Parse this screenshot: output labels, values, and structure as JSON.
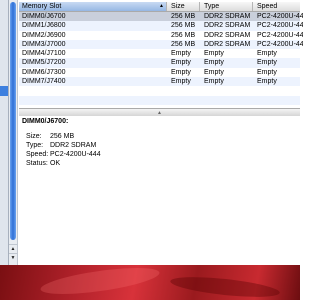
{
  "table": {
    "columns": [
      "Memory Slot",
      "Size",
      "Type",
      "Speed"
    ],
    "sort_indicator": "▲",
    "rows": [
      {
        "slot": "DIMM0/J6700",
        "size": "256 MB",
        "type": "DDR2 SDRAM",
        "speed": "PC2-4200U-444"
      },
      {
        "slot": "DIMM1/J6800",
        "size": "256 MB",
        "type": "DDR2 SDRAM",
        "speed": "PC2-4200U-444"
      },
      {
        "slot": "DIMM2/J6900",
        "size": "256 MB",
        "type": "DDR2 SDRAM",
        "speed": "PC2-4200U-444"
      },
      {
        "slot": "DIMM3/J7000",
        "size": "256 MB",
        "type": "DDR2 SDRAM",
        "speed": "PC2-4200U-444"
      },
      {
        "slot": "DIMM4/J7100",
        "size": "Empty",
        "type": "Empty",
        "speed": "Empty"
      },
      {
        "slot": "DIMM5/J7200",
        "size": "Empty",
        "type": "Empty",
        "speed": "Empty"
      },
      {
        "slot": "DIMM6/J7300",
        "size": "Empty",
        "type": "Empty",
        "speed": "Empty"
      },
      {
        "slot": "DIMM7/J7400",
        "size": "Empty",
        "type": "Empty",
        "speed": "Empty"
      }
    ]
  },
  "detail": {
    "title": "DIMM0/J6700:",
    "fields": [
      {
        "key": "Size:",
        "value": "256 MB"
      },
      {
        "key": "Type:",
        "value": "DDR2 SDRAM"
      },
      {
        "key": "Speed:",
        "value": "PC2-4200U-444"
      },
      {
        "key": "Status:",
        "value": "OK"
      }
    ]
  }
}
